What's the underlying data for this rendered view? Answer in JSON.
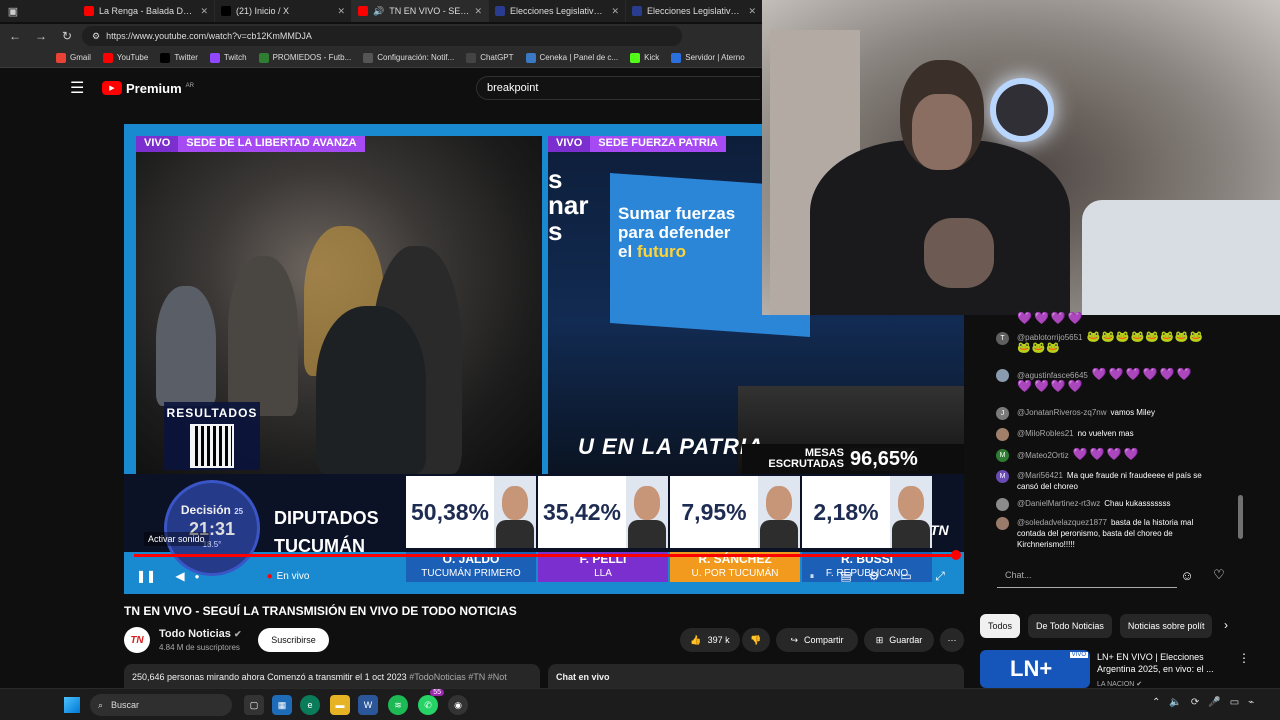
{
  "browser": {
    "tabs": [
      {
        "label": "La Renga - Balada Del Diablo",
        "color": "#ff0000",
        "active": false
      },
      {
        "label": "(21) Inicio / X",
        "color": "#000000",
        "active": false
      },
      {
        "label": "TN EN VIVO - SEGUÍ LA",
        "color": "#ff0000",
        "active": true
      },
      {
        "label": "Elecciones Legislativas 2025",
        "color": "#2a3c8f",
        "active": false
      },
      {
        "label": "Elecciones Legislativas 2025",
        "color": "#2a3c8f",
        "active": false
      }
    ],
    "url": "https://www.youtube.com/watch?v=cb12KmMMDJA",
    "bookmarks": [
      "Gmail",
      "YouTube",
      "Twitter",
      "Twitch",
      "PROMIEDOS - Futb...",
      "Configuración: Notif...",
      "ChatGPT",
      "Ceneka | Panel de c...",
      "Kick",
      "Servidor | Aterno"
    ]
  },
  "yt": {
    "logo_text": "Premium",
    "logo_sup": "AR",
    "search_query": "breakpoint"
  },
  "video": {
    "left_tag_vivo": "VIVO",
    "left_tag_place": "SEDE DE LA LIBERTAD AVANZA",
    "right_tag_vivo": "VIVO",
    "right_tag_place": "SEDE FUERZA PATRIA",
    "screen_line1": "Sumar fuerzas",
    "screen_line2": "para defender",
    "screen_line3a": "el",
    "screen_line3b": "futuro",
    "patria": "U EN LA PATRIA",
    "bigs": "s\nnar\ns",
    "resultados": "RESULTADOS",
    "mesas_label": "MESAS ESCRUTADAS",
    "mesas_value": "96,65%",
    "decision_title": "Decisión",
    "decision_year": "25",
    "decision_time": "21:31",
    "decision_temp": "18.5°",
    "dip_line1": "DIPUTADOS",
    "dip_line2": "TUCUMÁN",
    "tn_logo": "TN",
    "activar": "Activar sonido",
    "en_vivo": "En vivo",
    "candidates": [
      {
        "pct": "50,38%",
        "name": "O. JALDO",
        "party": "TUCUMÁN PRIMERO",
        "color": "#1c5fb7"
      },
      {
        "pct": "35,42%",
        "name": "F. PELLI",
        "party": "LLA",
        "color": "#7b2fcf"
      },
      {
        "pct": "7,95%",
        "name": "R. SÁNCHEZ",
        "party": "U. POR TUCUMÁN",
        "color": "#f29a1d"
      },
      {
        "pct": "2,18%",
        "name": "R. BUSSI",
        "party": "F. REPUBLICANO",
        "color": "#1c5fb7"
      }
    ]
  },
  "chat": {
    "messages": [
      {
        "user": "",
        "text": "💜💜💜💜",
        "kind": "hearts",
        "avatar": "",
        "avcolor": "#555"
      },
      {
        "user": "@pablotorrijo5651",
        "text": "🐸🐸🐸🐸🐸🐸🐸🐸🐸🐸🐸",
        "kind": "kermits",
        "avatar": "T",
        "avcolor": "#5f5f5f"
      },
      {
        "user": "@agustinfasce6645",
        "text": "💜💜💜💜💜💜💜💜💜💜",
        "kind": "hearts",
        "avatar": "",
        "avcolor": "#8a9bb0"
      },
      {
        "user": "@JonatanRiveros-zq7nw",
        "text": "vamos Miley",
        "kind": "text",
        "avatar": "J",
        "avcolor": "#7a7a7a"
      },
      {
        "user": "@MiloRobles21",
        "text": "no vuelven mas",
        "kind": "text",
        "avatar": "",
        "avcolor": "#a0806a"
      },
      {
        "user": "@Mateo2Ortiz",
        "text": "💜💜💜💜",
        "kind": "hearts",
        "avatar": "M",
        "avcolor": "#2e7d32"
      },
      {
        "user": "@Mari56421",
        "text": "Ma que fraude ni fraudeeee el país se cansó del choreo",
        "kind": "text",
        "avatar": "M",
        "avcolor": "#6a4bb5"
      },
      {
        "user": "@DanielMartinez-rt3wz",
        "text": "Chau kukasssssss",
        "kind": "text",
        "avatar": "",
        "avcolor": "#8b8b8b"
      },
      {
        "user": "@soledadvelazquez1877",
        "text": "basta de la historia mal contada del peronismo, basta del choreo de Kirchnerismo!!!!!",
        "kind": "text",
        "avatar": "",
        "avcolor": "#9a7b6b"
      }
    ],
    "input_placeholder": "Chat..."
  },
  "below": {
    "title": "TN EN VIVO - SEGUÍ LA TRANSMISIÓN EN VIVO DE TODO NOTICIAS",
    "channel": "Todo Noticias",
    "channel_avatar": "TN",
    "subscribers": "4.84 M de suscriptores",
    "subscribe": "Suscribirse",
    "likes": "397 k",
    "share": "Compartir",
    "save": "Guardar",
    "desc_stats": "250,646 personas mirando ahora  Comenzó a transmitir el 1 oct 2023",
    "desc_tags": "#TodoNoticias #TN #Not",
    "chat_live": "Chat en vivo"
  },
  "sidebar": {
    "chips": [
      "Todos",
      "De Todo Noticias",
      "Noticias sobre polít"
    ],
    "rec_title": "LN+ EN VIVO | Elecciones Argentina 2025, en vivo: el ...",
    "rec_channel": "LA NACION",
    "rec_thumb_text": "LN+",
    "rec_thumb_badge": "VIVO"
  },
  "taskbar": {
    "search": "Buscar",
    "badge": "55"
  }
}
